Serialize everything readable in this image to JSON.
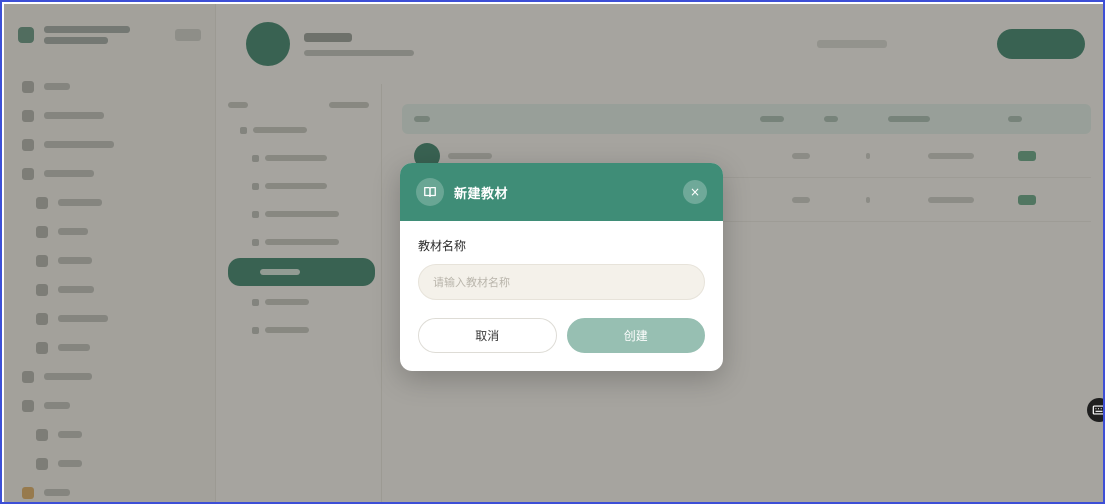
{
  "dialog": {
    "title": "新建教材",
    "icon": "book-icon",
    "close_glyph": "×",
    "field_label": "教材名称",
    "field_value": "",
    "field_placeholder": "请输入教材名称",
    "cancel_label": "取消",
    "create_label": "创建"
  },
  "colors": {
    "accent": "#3f8d77",
    "create_disabled": "#97bfb2",
    "input_bg": "#f4f1ea",
    "window_border": "#3d4fd6"
  },
  "floating_icon": "keyboard-icon"
}
